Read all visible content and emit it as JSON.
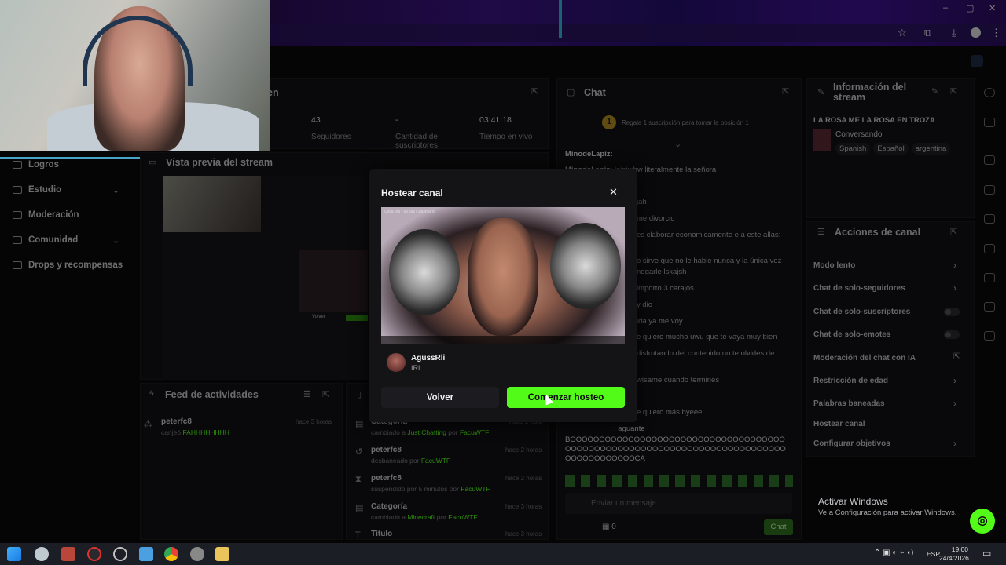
{
  "browser": {
    "window_controls": [
      "–",
      "▢",
      "✕"
    ],
    "toolbar_icons": [
      "star-icon",
      "extension-icon",
      "download-icon",
      "profile-icon",
      "menu-icon"
    ]
  },
  "sidebar": {
    "items": [
      {
        "label": "Logros"
      },
      {
        "label": "Estudio"
      },
      {
        "label": "Moderación"
      },
      {
        "label": "Comunidad"
      },
      {
        "label": "Drops y recompensas"
      }
    ]
  },
  "stats": {
    "title_fragment": "en",
    "items": [
      {
        "value": "43",
        "label": "Seguidores"
      },
      {
        "value": "-",
        "label": "Cantidad de suscriptores"
      },
      {
        "value": "03:41:18",
        "label": "Tiempo en vivo"
      }
    ]
  },
  "preview": {
    "title": "Vista previa del stream",
    "cancel": "Volver"
  },
  "chat": {
    "title": "Chat",
    "gift_text": "Regala 1 suscripción para tomar la posición 1",
    "gift_rank": "1",
    "lines": [
      {
        "name": "MinodeLapiz:",
        "text": ""
      },
      {
        "name": "Minodel apiz:",
        "text": "lajajwhw literalmente la señora"
      },
      {
        "name": "",
        "text": "jah"
      },
      {
        "name": "",
        "text": "me divorcio"
      },
      {
        "name": "",
        "text": "es claborar economicamente e a este allas:"
      },
      {
        "name": "",
        "text": "o sirve que no le hable nunca y la única vez"
      },
      {
        "name": "",
        "text": "negarle lskajsh"
      },
      {
        "name": "",
        "text": "importo 3 carajos"
      },
      {
        "name": "",
        "text": "y dio"
      },
      {
        "name": "",
        "text": "ida ya me voy"
      },
      {
        "name": "",
        "text": "e quiero mucho uwu que te vaya muy bien"
      },
      {
        "name": "",
        "text": "disfrutando del contenido no te olvides de"
      },
      {
        "name": "",
        "text": "wisame cuando termines"
      },
      {
        "name": "",
        "text": "e quiero más byeee"
      },
      {
        "name": "",
        "text": ": aguante"
      },
      {
        "name": "",
        "text": "BOOOOOOOOOOOOOOOOOOOOOOOOOOOOOOOOOOOOOOOOOOOOOOOOOOOOOOOOOOOOOOOOOOOOOOOOOOOOOOOOOOOOOOOCA"
      }
    ],
    "input_placeholder": "Enviar un mensaje",
    "points": "0",
    "send": "Chat"
  },
  "info": {
    "title": "Información del stream",
    "stream_title": "LA ROSA ME LA ROSA EN TROZA",
    "category": "Conversando",
    "tags": [
      "Spanish",
      "Español",
      "argentina"
    ]
  },
  "actions": {
    "title": "Acciones de canal",
    "items": [
      {
        "label": "Modo lento",
        "kind": "arrow"
      },
      {
        "label": "Chat de solo-seguidores",
        "kind": "arrow"
      },
      {
        "label": "Chat de solo-suscriptores",
        "kind": "toggle"
      },
      {
        "label": "Chat de solo-emotes",
        "kind": "toggle"
      },
      {
        "label": "Moderación del chat con IA",
        "kind": "external"
      },
      {
        "label": "Restricción de edad",
        "kind": "arrow"
      },
      {
        "label": "Palabras baneadas",
        "kind": "arrow"
      },
      {
        "label": "Hostear canal",
        "kind": "none"
      },
      {
        "label": "Configurar objetivos",
        "kind": "arrow"
      }
    ]
  },
  "feed": {
    "title": "Feed de actividades",
    "left": [
      {
        "name": "peterfc8",
        "time": "hace 3 horas",
        "text": "canjeó ",
        "highlight": "FAHHHHHHHH"
      }
    ],
    "right": [
      {
        "name": "Categoría",
        "time": "hace 1 hora",
        "text": "cambiado a ",
        "highlight": "Just Chatting",
        "by": " por ",
        "user": "FacuWTF"
      },
      {
        "name": "peterfc8",
        "time": "hace 2 horas",
        "text": "desbaneado por ",
        "highlight": "",
        "by": "",
        "user": "FacuWTF"
      },
      {
        "name": "peterfc8",
        "time": "hace 2 horas",
        "text": "suspendido por 5 minutos por ",
        "highlight": "",
        "by": "",
        "user": "FacuWTF"
      },
      {
        "name": "Categoría",
        "time": "hace 3 horas",
        "text": "cambiado a ",
        "highlight": "Minecraft",
        "by": " por ",
        "user": "FacuWTF"
      },
      {
        "name": "Título",
        "time": "hace 3 horas",
        "text": "",
        "highlight": "",
        "by": "",
        "user": ""
      }
    ]
  },
  "modal": {
    "title": "Hostear canal",
    "video_caption": "Cosa fea - Mi sus Chasmarra",
    "channel_name": "AgussRli",
    "channel_category": "IRL",
    "cancel": "Volver",
    "confirm": "Comenzar hosteo"
  },
  "windows": {
    "activate_title": "Activar Windows",
    "activate_sub": "Ve a Configuración para activar Windows.",
    "time": "19:00",
    "date": "24/4/2026",
    "lang": "ESP"
  },
  "colors": {
    "accent_green": "#53fc18",
    "bg": "#0a0a0b",
    "panel": "#121214"
  }
}
